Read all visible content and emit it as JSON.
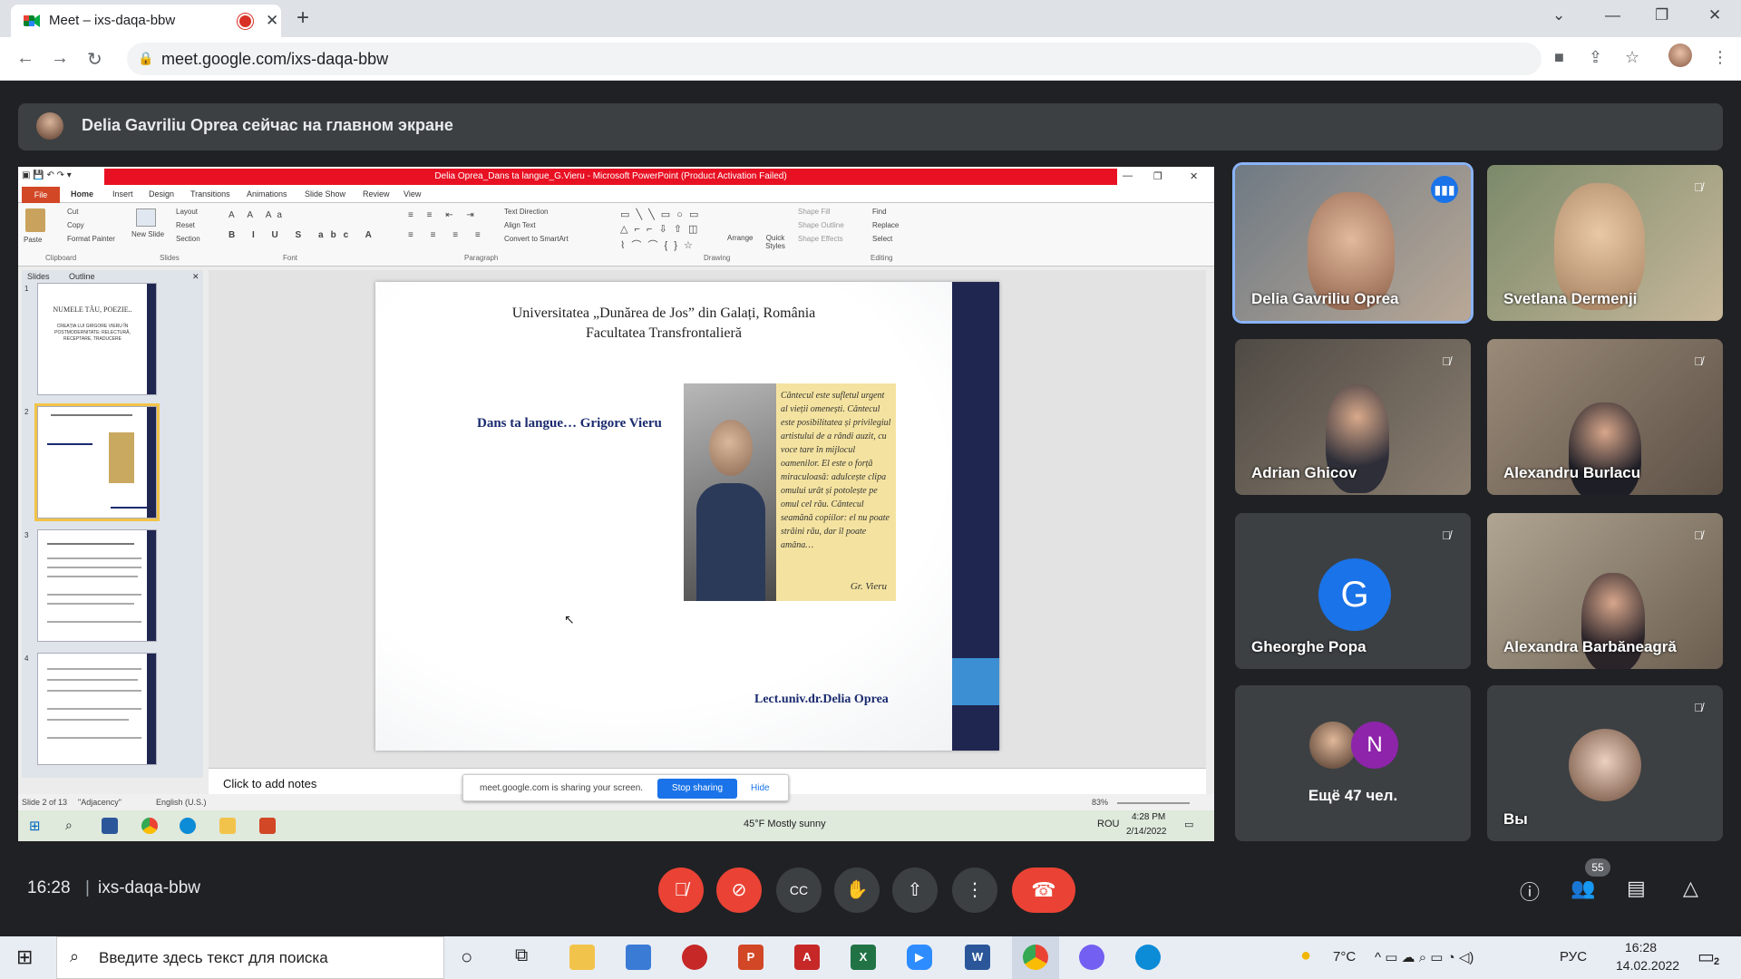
{
  "browser": {
    "tab_title": "Meet – ixs-daqa-bbw",
    "url": "meet.google.com/ixs-daqa-bbw"
  },
  "meet": {
    "presenter_banner": "Delia Gavriliu Oprea сейчас на главном экране",
    "meeting_time": "16:28",
    "meeting_code": "ixs-daqa-bbw",
    "participant_count": "55",
    "participants": [
      {
        "name": "Delia Gavriliu Oprea",
        "speaking": true
      },
      {
        "name": "Svetlana Dermenji"
      },
      {
        "name": "Adrian Ghicov"
      },
      {
        "name": "Alexandru Burlacu"
      },
      {
        "name": "Gheorghe Popa",
        "initial": "G"
      },
      {
        "name": "Alexandra Barbăneagră"
      },
      {
        "name": "Ещё 47 чел.",
        "initial": "N"
      },
      {
        "name": "Вы"
      }
    ]
  },
  "powerpoint": {
    "window_title": "Delia Oprea_Dans ta langue_G.Vieru - Microsoft PowerPoint (Product Activation Failed)",
    "tabs": [
      "Home",
      "Insert",
      "Design",
      "Transitions",
      "Animations",
      "Slide Show",
      "Review",
      "View"
    ],
    "file_tab": "File",
    "groups": [
      "Clipboard",
      "Slides",
      "Font",
      "Paragraph",
      "Drawing",
      "Editing"
    ],
    "ribbon_items": {
      "paste": "Paste",
      "cut": "Cut",
      "copy": "Copy",
      "format_painter": "Format Painter",
      "new_slide": "New Slide",
      "layout": "Layout",
      "reset": "Reset",
      "section": "Section",
      "text_direction": "Text Direction",
      "align_text": "Align Text",
      "convert": "Convert to SmartArt",
      "arrange": "Arrange",
      "quick_styles": "Quick Styles",
      "shape_fill": "Shape Fill",
      "shape_outline": "Shape Outline",
      "shape_effects": "Shape Effects",
      "find": "Find",
      "replace": "Replace",
      "select": "Select"
    },
    "panel_tabs": [
      "Slides",
      "Outline"
    ],
    "slide_numbers": [
      "1",
      "2",
      "3",
      "4"
    ],
    "thumb1_lines": [
      "NUMELE TĂU, POEZIE..",
      "CREAȚIA LUI GRIGORE VIERU ÎN POSTMODERNITATE: RELECTURĂ, RECEPTARE, TRADUCERE"
    ],
    "slide": {
      "university": "Universitatea „Dunărea de Jos” din Galați, România",
      "faculty": "Facultatea Transfrontalieră",
      "title": "Dans ta langue… Grigore Vieru",
      "poem": "Cântecul este sufletul urgent al vieții omenești. Cântecul este posibilitatea și privilegiul artistului de a rândi auzit, cu voce tare în mijlocul oamenilor. El este o forță miraculoasă: adulcește clipa omului urât și potolește pe omul cel rău. Cântecul seamănă copiilor: el nu poate străini rău, dar îl poate amâna…",
      "signature": "Gr. Vieru",
      "author": "Lect.univ.dr.Delia Oprea"
    },
    "notes_placeholder": "Click to add notes",
    "status": {
      "slide": "Slide 2 of 13",
      "theme": "\"Adjacency\"",
      "lang": "English (U.S.)",
      "zoom": "83%"
    },
    "sharebar": {
      "message": "meet.google.com is sharing your screen.",
      "stop": "Stop sharing",
      "hide": "Hide"
    },
    "inner_taskbar": {
      "weather": "45°F Mostly sunny",
      "lang": "ROU",
      "time": "4:28 PM",
      "date": "2/14/2022"
    }
  },
  "taskbar": {
    "search_placeholder": "Введите здесь текст для поиска",
    "temperature": "7°C",
    "lang": "РУС",
    "time": "16:28",
    "date": "14.02.2022",
    "notifications": "2"
  }
}
